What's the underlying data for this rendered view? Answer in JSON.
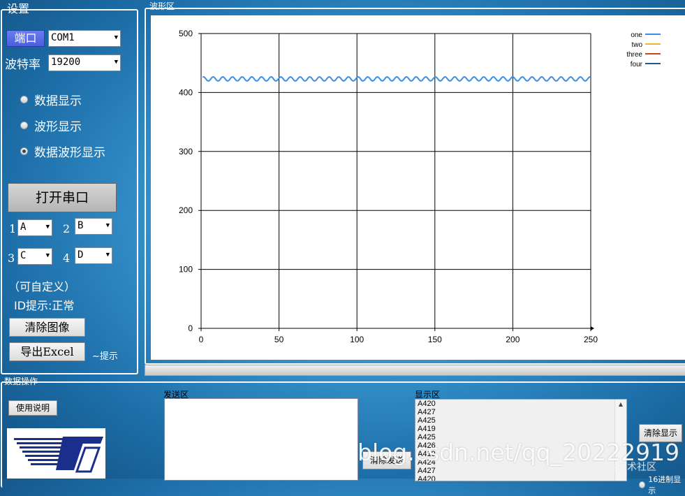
{
  "settings": {
    "title": "设置",
    "port_label": "端口",
    "port_value": "COM1",
    "baud_label": "波特率",
    "baud_value": "19200",
    "radio": [
      "数据显示",
      "波形显示",
      "数据波形显示"
    ],
    "radio_selected": 2,
    "open_port_button": "打开串口",
    "channels": [
      {
        "num": "1",
        "value": "A"
      },
      {
        "num": "2",
        "value": "B"
      },
      {
        "num": "3",
        "value": "C"
      },
      {
        "num": "4",
        "value": "D"
      }
    ],
    "custom_note": "（可自定义）",
    "id_hint": "ID提示:正常",
    "clear_image_button": "清除图像",
    "export_excel_button": "导出Excel",
    "hint_label": "~提示"
  },
  "waveform": {
    "title": "波形区"
  },
  "chart_data": {
    "type": "line",
    "xlim": [
      0,
      250
    ],
    "ylim": [
      0,
      500
    ],
    "xticks": [
      "0",
      "50",
      "100",
      "150",
      "200",
      "250"
    ],
    "yticks": [
      "0",
      "100",
      "200",
      "300",
      "400",
      "500"
    ],
    "grid": true,
    "legend_position": "top-right",
    "series": [
      {
        "name": "one",
        "color": "#3a8ee6",
        "description_values": {
          "mean": 423,
          "amplitude": 3.5,
          "period": 6.2,
          "x_start": 1,
          "x_end": 250
        }
      },
      {
        "name": "two",
        "color": "#f0b428",
        "values": []
      },
      {
        "name": "three",
        "color": "#c8461e",
        "values": []
      },
      {
        "name": "four",
        "color": "#1e5a8c",
        "values": []
      }
    ]
  },
  "data_ops": {
    "title": "数据操作",
    "instructions_button": "使用说明",
    "send_area_label": "发送区",
    "display_area_label": "显示区",
    "clear_send_button": "清除发送",
    "clear_display_button": "清除显示",
    "received": [
      "A420",
      "A427",
      "A425",
      "A419",
      "A425",
      "A426",
      "A419",
      "A424",
      "A427",
      "A420"
    ],
    "hex_display_label": "16进制显示"
  },
  "watermark": {
    "main": "blog.csdn.net/qq_20222919",
    "sub": "@稀土掘金技术社区"
  }
}
